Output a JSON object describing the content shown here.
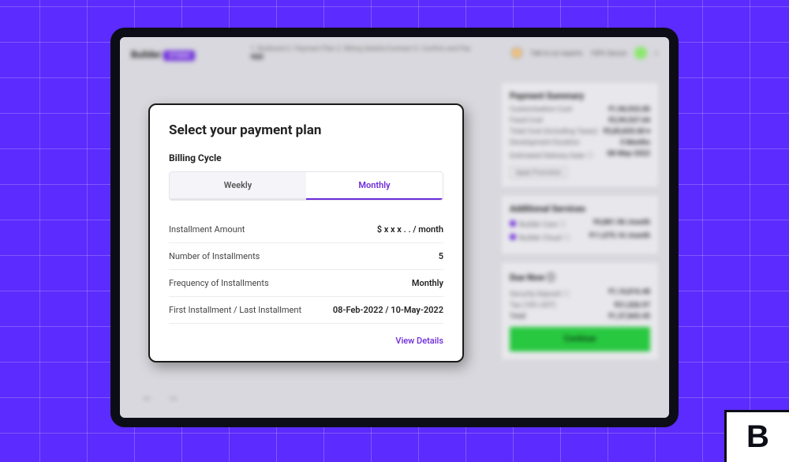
{
  "brand": {
    "name": "Builder",
    "badge": "STUDIO"
  },
  "breadcrumbs": {
    "steps": "1. Buildcard   2. Payment Plan   3. Billing Details/Contract   4. Confirm and Pay",
    "appname": "app"
  },
  "header": {
    "talk": "Talk to our experts",
    "secure": "100% Secure"
  },
  "modal": {
    "title": "Select your payment plan",
    "subtitle": "Billing Cycle",
    "tabs": {
      "weekly": "Weekly",
      "monthly": "Monthly"
    },
    "rows": {
      "installment_amount": {
        "label": "Installment Amount",
        "value": "$ x x x . . / month"
      },
      "num_installments": {
        "label": "Number of Installments",
        "value": "5"
      },
      "frequency": {
        "label": "Frequency of Installments",
        "value": "Monthly"
      },
      "first_last": {
        "label": "First Installment / Last Installment",
        "value": "08-Feb-2022 / 10-May-2022"
      }
    },
    "view_details": "View Details"
  },
  "summary": {
    "title": "Payment Summary",
    "customisation": {
      "label": "Customisation Cost",
      "value": "₹1,96,933.00"
    },
    "fixed": {
      "label": "Fixed Cost",
      "value": "₹2,99,537.04"
    },
    "total_cost": {
      "label": "Total Cost (Including Taxes)",
      "value": "₹5,85,835.00 ▾"
    },
    "duration": {
      "label": "Development Duration",
      "value": "5 Months"
    },
    "delivery": {
      "label": "Estimated Delivery Date ⓘ",
      "value": "08-May-2022"
    },
    "promo": "Apply Promotion"
  },
  "additional": {
    "title": "Additional Services",
    "care": {
      "label": "Builder Care ⓘ",
      "value": "₹4,881.96 /month"
    },
    "cloud": {
      "label": "Builder Cloud ⓘ",
      "value": "₹11,075.16 /month"
    }
  },
  "due": {
    "title": "Due Now ⓘ",
    "deposit": {
      "label": "Security Deposit ⓘ",
      "value": "₹1,16,816.48"
    },
    "tax": {
      "label": "Tax (18% GST)",
      "value": "₹21,026.97"
    },
    "total": {
      "label": "Total",
      "value": "₹1,37,843.45"
    },
    "continue": "Continue"
  },
  "corner_logo": "B"
}
